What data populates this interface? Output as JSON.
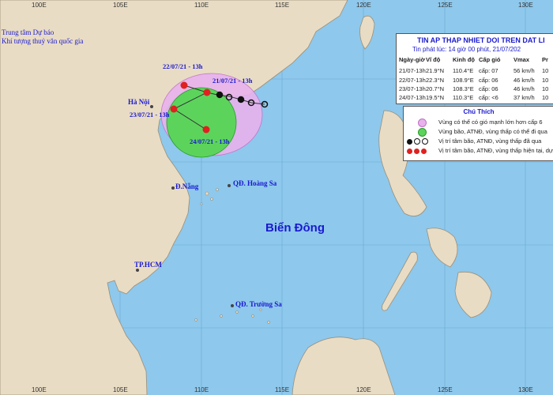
{
  "agency": {
    "line1": "Trung tâm Dự báo",
    "line2": "Khí tượng thuỷ văn quốc gia"
  },
  "longitudes": {
    "top": [
      "100E",
      "105E",
      "110E",
      "115E",
      "120E",
      "125E",
      "130E"
    ],
    "bottom": [
      "100E",
      "105E",
      "110E",
      "115E",
      "120E",
      "125E",
      "130E"
    ]
  },
  "places": {
    "hanoi": "Hà Nội",
    "danang": "Đ.Nẵng",
    "hoangsa": "QĐ. Hoàng Sa",
    "hcm": "TP.HCM",
    "truongsa": "QĐ. Trường Sa"
  },
  "sea_name": "Biển Đông",
  "forecast_labels": {
    "p22": "22/07/21 - 13h",
    "p21": "21/07/21 - 13h",
    "p23": "23/07/21 - 13h",
    "p24": "24/07/21 - 13h"
  },
  "bulletin": {
    "title": "TIN AP THAP NHIET DOI TREN DAT LI",
    "issued": "Tin phát lúc: 14 giờ 00 phút, 21/07/202",
    "headers": [
      "Ngày-giờ",
      "Vĩ độ",
      "Kinh độ",
      "Cấp gió",
      "Vmax",
      "Pr"
    ],
    "rows": [
      [
        "21/07-13h",
        "21.9°N",
        "110.4°E",
        "cấp: 07",
        "56 km/h",
        "10"
      ],
      [
        "22/07-13h",
        "22.3°N",
        "108.9°E",
        "cấp: 06",
        "46 km/h",
        "10"
      ],
      [
        "23/07-13h",
        "20.7°N",
        "108.3°E",
        "cấp: 06",
        "46 km/h",
        "10"
      ],
      [
        "24/07-13h",
        "19.5°N",
        "110.3°E",
        "cấp: <6",
        "37 km/h",
        "10"
      ]
    ]
  },
  "key": {
    "title": "Chú Thích",
    "items": [
      {
        "text": "Vùng có thể có gió mạnh lớn hơn cấp 6",
        "icon": "purple-zone"
      },
      {
        "text": "Vùng bão, ATNĐ, vùng thấp có thể đi qua",
        "icon": "green-zone"
      },
      {
        "text": "Vị trí tâm bão, ATNĐ, vùng thấp đã qua",
        "icon": "past-track-symbols"
      },
      {
        "text": "Vị trí tâm bão, ATNĐ, vùng thấp hiện tại, dự",
        "icon": "forecast-track-symbols"
      }
    ]
  },
  "colors": {
    "sea": "#8ec8ec",
    "land": "#e9dcc4",
    "green_zone": "#5cd45c",
    "purple_zone": "#e8b2ec",
    "text_blue": "#1a1ad0",
    "forecast_center": "#e02020"
  }
}
